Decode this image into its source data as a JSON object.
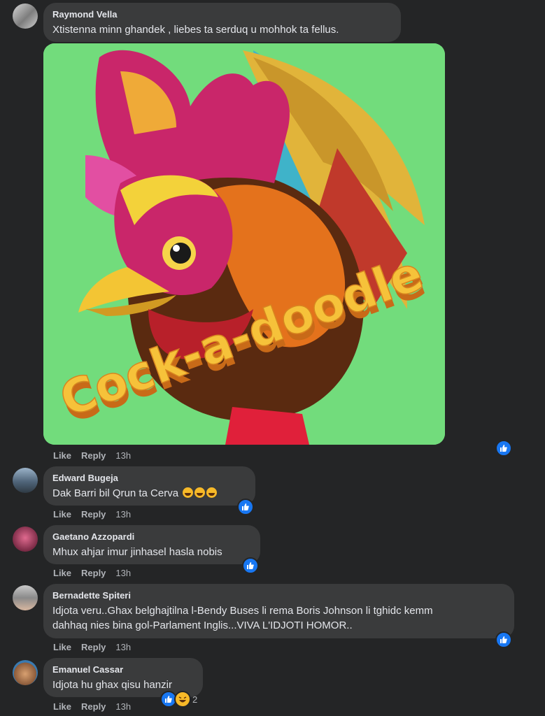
{
  "actions": {
    "like": "Like",
    "reply": "Reply"
  },
  "comments": [
    {
      "author": "Raymond Vella",
      "text": "Xtistenna minn ghandek , liebes ta serduq u mohhok ta fellus.",
      "time": "13h",
      "image_caption": "Cock-a-doodle",
      "reactions": [
        "like"
      ]
    },
    {
      "author": "Edward Bugeja",
      "text": "Dak Barri bil Qrun ta Cerva",
      "time": "13h",
      "reactions": [
        "like"
      ]
    },
    {
      "author": "Gaetano Azzopardi",
      "text": "Mhux ahjar imur jinhasel hasla nobis",
      "time": "13h",
      "reactions": [
        "like"
      ]
    },
    {
      "author": "Bernadette Spiteri",
      "text_line1": "Idjota veru..Ghax belghajtilna l-Bendy Buses li rema Boris Johnson li tghidc kemm",
      "text_line2": "dahhaq nies bina gol-Parlament Inglis...VIVA L'IDJOTI HOMOR..",
      "time": "13h",
      "reactions": [
        "like"
      ]
    },
    {
      "author": "Emanuel Cassar",
      "text": "Idjota hu ghax qisu hanzir",
      "time": "13h",
      "reactions": [
        "like",
        "haha"
      ],
      "reaction_count": "2"
    }
  ],
  "colors": {
    "background": "#242526",
    "bubble": "#3a3b3c",
    "like": "#1877f2",
    "haha": "#f7b928"
  }
}
